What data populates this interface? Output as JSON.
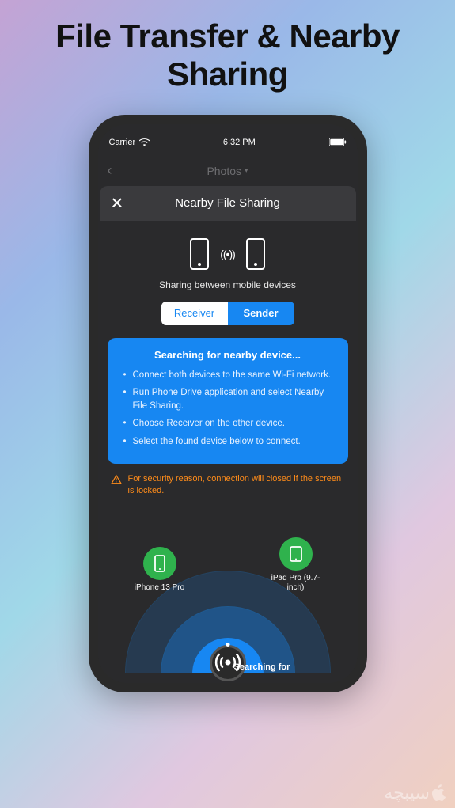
{
  "headline": "File Transfer & Nearby Sharing",
  "statusbar": {
    "carrier": "Carrier",
    "time": "6:32 PM"
  },
  "dim_header": {
    "title": "Photos"
  },
  "modal": {
    "title": "Nearby File Sharing"
  },
  "sharing_caption": "Sharing between mobile devices",
  "segmented": {
    "receiver": "Receiver",
    "sender": "Sender"
  },
  "info": {
    "title": "Searching for nearby device...",
    "items": [
      "Connect both devices to the same Wi-Fi network.",
      "Run Phone Drive application and select Nearby File Sharing.",
      "Choose Receiver on the other device.",
      "Select the found device below to connect."
    ]
  },
  "warning": "For security reason, connection will closed if the screen is locked.",
  "radar": {
    "searching_label": "Searching for",
    "left_device": "iPhone 13 Pro",
    "right_device": "iPad Pro (9.7-inch)"
  },
  "watermark": "سیبچه"
}
